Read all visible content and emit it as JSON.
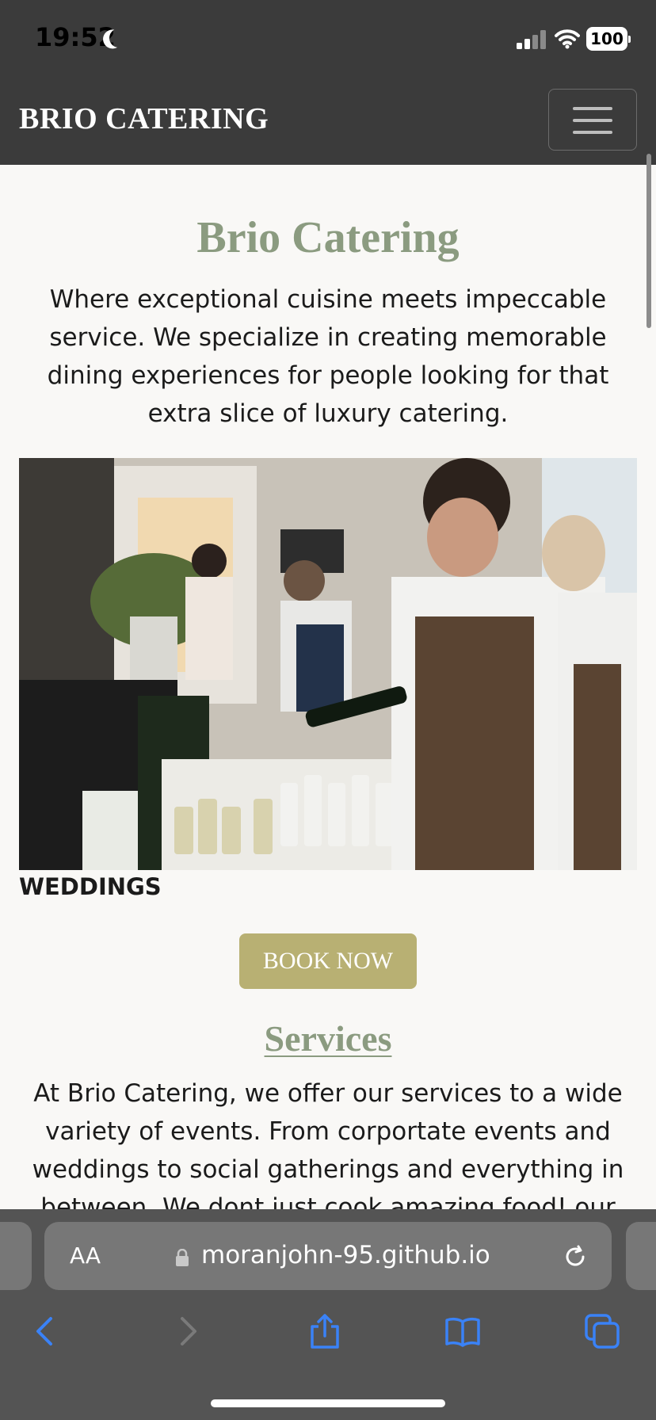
{
  "status_bar": {
    "time": "19:52",
    "battery": "100"
  },
  "navbar": {
    "brand": "BRIO CATERING"
  },
  "hero": {
    "title": "Brio Catering",
    "text": "Where exceptional cuisine meets impeccable service. We specialize in creating memorable dining experiences for people looking for that extra slice of luxury catering."
  },
  "feature": {
    "caption": "WEDDINGS",
    "button_label": "BOOK NOW"
  },
  "services": {
    "title": "Services",
    "text": "At Brio Catering, we offer our services to a wide variety of events. From corportate events and weddings to social gatherings and everything in between. We dont just cook amazing food! our"
  },
  "browser": {
    "text_size_label": "AA",
    "url": "moranjohn-95.github.io"
  },
  "colors": {
    "accent": "#8b9b80",
    "button": "#b8b073",
    "navbar": "#3b3b3b",
    "ios_blue": "#3a82f7"
  }
}
